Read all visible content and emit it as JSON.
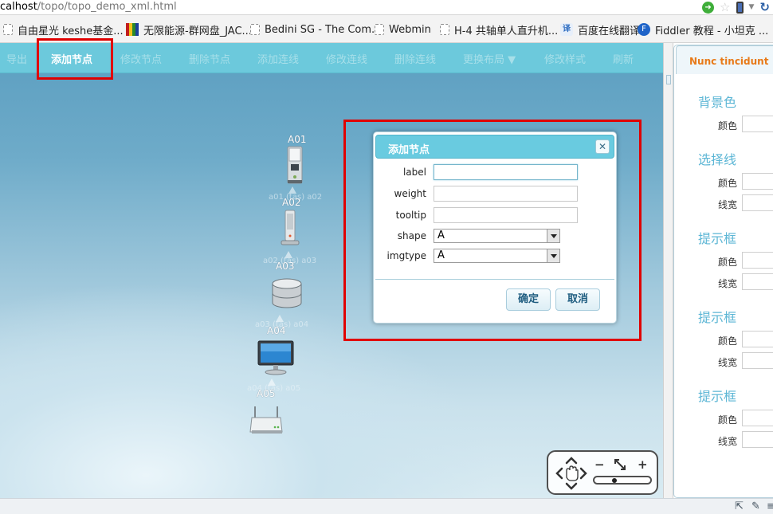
{
  "browser": {
    "url_host": "calhost",
    "url_path": "/topo/topo_demo_xml.html",
    "go_icon": "arrow-right-circle-icon",
    "star_icon": "star-icon",
    "refresh_icon": "refresh-icon"
  },
  "bookmarks": [
    {
      "label": "自由星光 keshe基金...",
      "icon": "page-icon"
    },
    {
      "label": "无限能源-群网盘_JAC...",
      "icon": "mosaic-icon"
    },
    {
      "label": "Bedini SG - The Com...",
      "icon": "page-icon"
    },
    {
      "label": "Webmin",
      "icon": "page-icon"
    },
    {
      "label": "H-4 共轴单人直升机...",
      "icon": "page-icon"
    },
    {
      "label": "百度在线翻译",
      "icon": "translate-icon"
    },
    {
      "label": "Fiddler 教程 - 小坦克 ...",
      "icon": "fiddler-icon"
    }
  ],
  "toolbar": {
    "items": [
      "导出",
      "添加节点",
      "修改节点",
      "删除节点",
      "添加连线",
      "修改连线",
      "删除连线",
      "更换布局 ▼",
      "修改样式",
      "刷新"
    ],
    "active_index": 1
  },
  "topology": {
    "nodes": [
      {
        "label": "A01",
        "icon": "server-tower-icon"
      },
      {
        "label": "A02",
        "icon": "server-pillar-icon"
      },
      {
        "label": "A03",
        "icon": "database-icon"
      },
      {
        "label": "A04",
        "icon": "monitor-icon"
      },
      {
        "label": "A05",
        "icon": "router-icon"
      }
    ],
    "edges": [
      {
        "label": "a01 (tas) a02"
      },
      {
        "label": "a02 (tas) a03"
      },
      {
        "label": "a03 (tas) a04"
      },
      {
        "label": "a04 (tas) a05"
      }
    ]
  },
  "dialog": {
    "title": "添加节点",
    "close_icon": "close-icon",
    "fields": [
      {
        "label": "label",
        "value": ""
      },
      {
        "label": "weight",
        "value": ""
      },
      {
        "label": "tooltip",
        "value": ""
      }
    ],
    "selects": [
      {
        "label": "shape",
        "value": "A"
      },
      {
        "label": "imgtype",
        "value": "A"
      }
    ],
    "ok_label": "确定",
    "cancel_label": "取消"
  },
  "panel": {
    "tab_title": "Nunc tincidunt",
    "sections": [
      {
        "title": "背景色",
        "rows": [
          "颜色"
        ]
      },
      {
        "title": "选择线",
        "rows": [
          "颜色",
          "线宽"
        ]
      },
      {
        "title": "提示框",
        "rows": [
          "颜色",
          "线宽"
        ]
      },
      {
        "title": "提示框",
        "rows": [
          "颜色",
          "线宽"
        ]
      },
      {
        "title": "提示框",
        "rows": [
          "颜色",
          "线宽"
        ]
      }
    ]
  },
  "navigator": {
    "zoom_out": "−",
    "zoom_in": "+",
    "zoom_level": 0.35
  },
  "colors": {
    "toolbar": "#6cc9dc",
    "dialog_header": "#69cbe0",
    "highlight": "#e00000",
    "panel_tab": "#e87a19",
    "panel_heading": "#5cb6d5"
  }
}
